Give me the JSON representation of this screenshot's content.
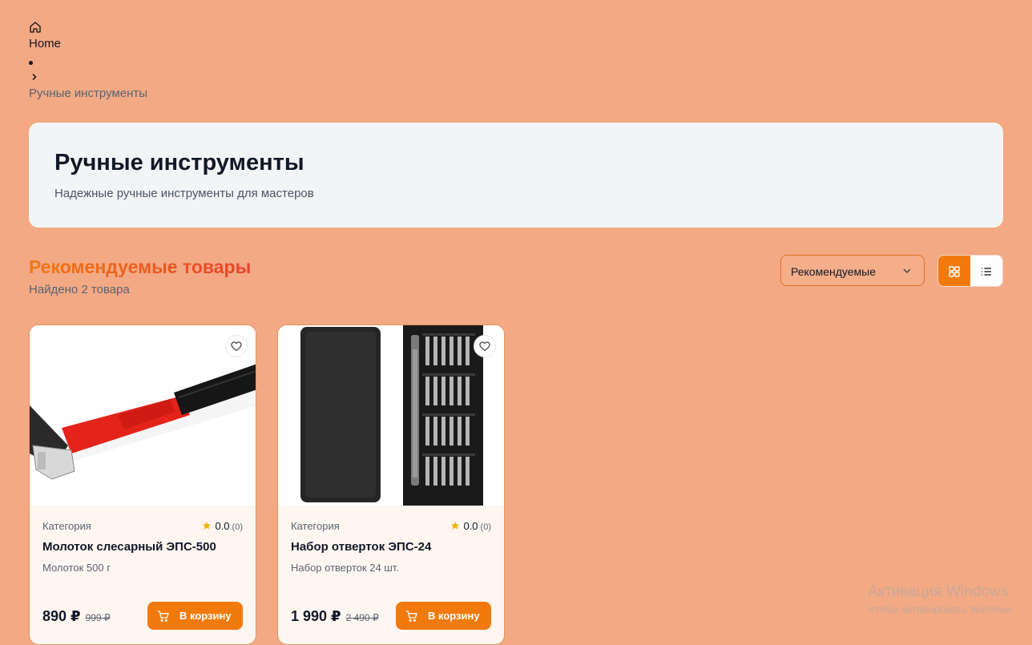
{
  "breadcrumb": {
    "home_icon": "home-icon",
    "home_label": "Home",
    "separator_icon": "chevron-right-icon",
    "current": "Ручные инструменты"
  },
  "hero": {
    "title": "Ручные инструменты",
    "subtitle": "Надежные ручные инструменты для мастеров"
  },
  "section": {
    "title": "Рекомендуемые товары",
    "found": "Найдено 2 товара"
  },
  "sort": {
    "selected": "Рекомендуемые",
    "icon": "chevron-down-icon"
  },
  "view_toggle": {
    "active": "grid",
    "grid_icon": "grid-icon",
    "list_icon": "list-icon"
  },
  "colors": {
    "background": "#f2a984",
    "accent": "#f27a0d",
    "hero_bg": "#f3f4f6",
    "star": "#f5b301"
  },
  "products": [
    {
      "image_icon": "hammer-image",
      "category": "Категория",
      "rating": "0.0",
      "rating_count": "(0)",
      "name": "Молоток слесарный ЭПС-500",
      "description": "Молоток 500 г",
      "price": "890 ₽",
      "old_price": "999 ₽",
      "cart_label": "В корзину"
    },
    {
      "image_icon": "screwdriver-set-image",
      "category": "Категория",
      "rating": "0.0",
      "rating_count": "(0)",
      "name": "Набор отверток ЭПС-24",
      "description": "Набор отверток 24 шт.",
      "price": "1 990 ₽",
      "old_price": "2 490 ₽",
      "cart_label": "В корзину"
    }
  ],
  "watermark": {
    "title": "Активация Windows",
    "subtitle": "Чтобы активировать Windows"
  }
}
